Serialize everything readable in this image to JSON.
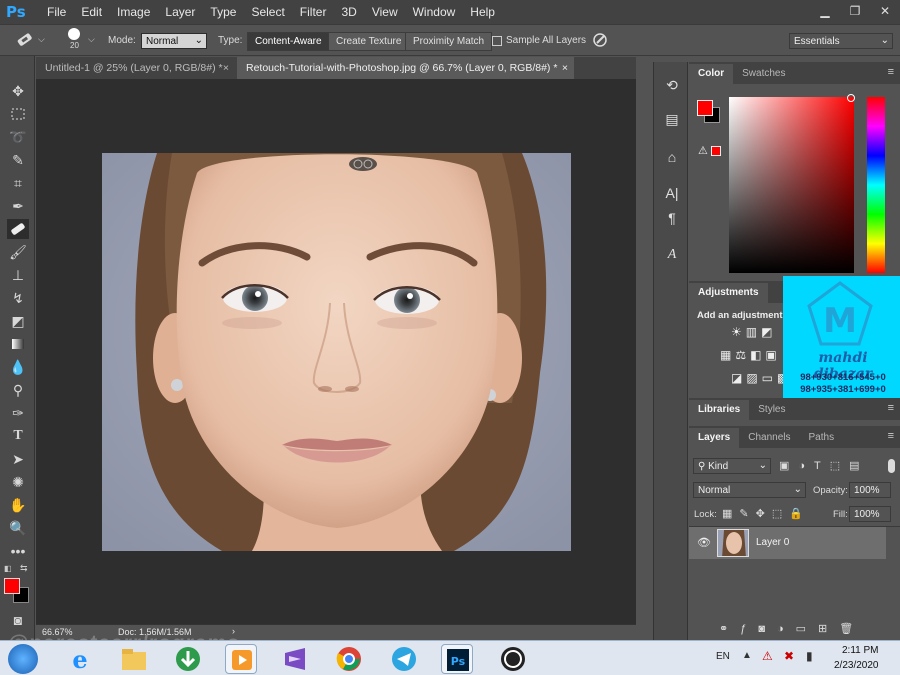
{
  "app": {
    "name": "Photoshop",
    "logo_text": "Ps"
  },
  "menu": [
    "File",
    "Edit",
    "Image",
    "Layer",
    "Type",
    "Select",
    "Filter",
    "3D",
    "View",
    "Window",
    "Help"
  ],
  "options": {
    "brush_size": "20",
    "mode_label": "Mode:",
    "mode_value": "Normal",
    "type_label": "Type:",
    "type_buttons": [
      "Content-Aware",
      "Create Texture",
      "Proximity Match"
    ],
    "sample_all_layers": "Sample All Layers",
    "workspace": "Essentials"
  },
  "tabs": [
    {
      "label": "Untitled-1 @ 25% (Layer 0, RGB/8#) *",
      "active": false
    },
    {
      "label": "Retouch-Tutorial-with-Photoshop.jpg @ 66.7% (Layer 0, RGB/8#) *",
      "active": true
    }
  ],
  "status": {
    "zoom": "66.67%",
    "doc": "Doc: 1.56M/1.56M"
  },
  "color_panel": {
    "tabs": [
      "Color",
      "Swatches"
    ],
    "foreground": "#ff0000",
    "background": "#000000"
  },
  "adjustments_panel": {
    "tab": "Adjustments",
    "text": "Add an adjustment"
  },
  "watermark": {
    "name": "mahdi dibazar",
    "phone1": "98+930+816+545+0",
    "phone2": "98+935+381+699+0",
    "color": "#00d8ff"
  },
  "libraries_panel": {
    "tabs": [
      "Libraries",
      "Styles"
    ]
  },
  "layers_panel": {
    "tabs": [
      "Layers",
      "Channels",
      "Paths"
    ],
    "filter": "Kind",
    "blend": "Normal",
    "opacity_label": "Opacity:",
    "opacity": "100%",
    "lock_label": "Lock:",
    "fill_label": "Fill:",
    "fill": "100%",
    "layer_name": "Layer 0"
  },
  "taskbar": {
    "lang": "EN",
    "time": "2:11 PM",
    "date": "2/23/2020"
  },
  "overlay_text": "@parastaarr/rograms"
}
